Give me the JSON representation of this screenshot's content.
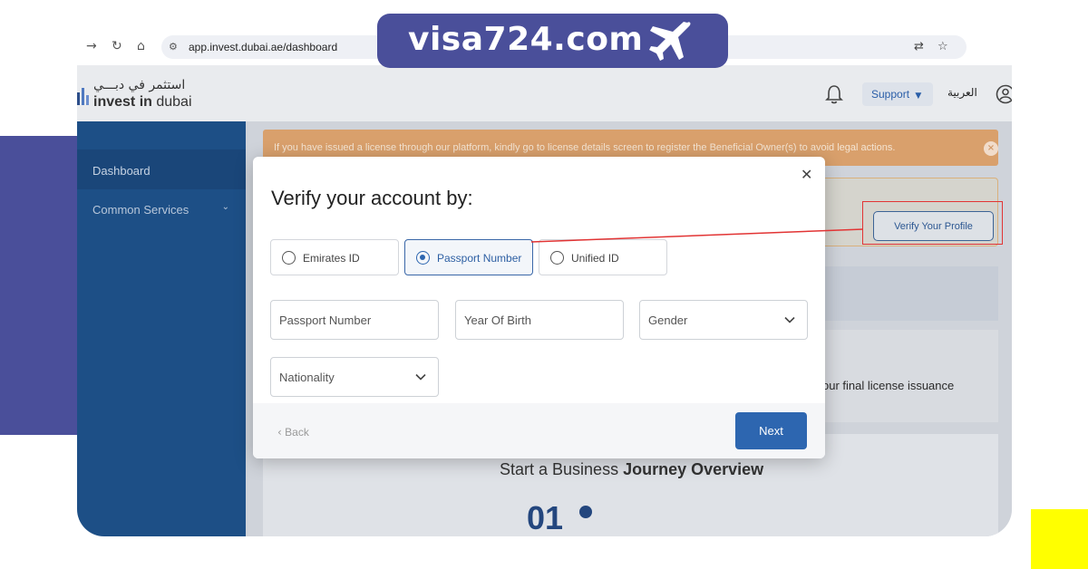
{
  "brand": {
    "name": "visa724.com",
    "colors": {
      "badge": "#4a4f9a",
      "accent_yellow": "#ffff00"
    }
  },
  "browser": {
    "url": "app.invest.dubai.ae/dashboard",
    "icons": [
      "forward-icon",
      "reload-icon",
      "home-icon",
      "site-info-icon",
      "translate-icon",
      "bookmark-star-icon"
    ]
  },
  "header": {
    "logo_arabic": "استثمر في دبـــي",
    "logo_invest": "invest in",
    "logo_dubai": "dubai",
    "support_label": "Support",
    "language_label": "العربية"
  },
  "sidebar": {
    "items": [
      {
        "label": "Dashboard",
        "active": true
      },
      {
        "label": "Common Services",
        "active": false
      }
    ]
  },
  "alert": {
    "text": "If you have issued a license through our platform, kindly go to license details screen to register the Beneficial Owner(s) to avoid legal actions.",
    "color": "#d9a06c"
  },
  "profile": {
    "verify_button": "Verify Your Profile"
  },
  "info": {
    "text": "our final license issuance"
  },
  "overview": {
    "title_prefix": "Start a Business",
    "title_bold": "Journey Overview",
    "step": "01"
  },
  "modal": {
    "title": "Verify your account by:",
    "options": [
      {
        "label": "Emirates ID",
        "selected": false
      },
      {
        "label": "Passport Number",
        "selected": true
      },
      {
        "label": "Unified ID",
        "selected": false
      }
    ],
    "fields": {
      "passport": "Passport Number",
      "year_of_birth": "Year Of Birth",
      "gender": "Gender",
      "nationality": "Nationality"
    },
    "back_label": "Back",
    "next_label": "Next",
    "primary_color": "#2d66b0"
  },
  "annotation": {
    "highlight_color": "#e23434"
  }
}
